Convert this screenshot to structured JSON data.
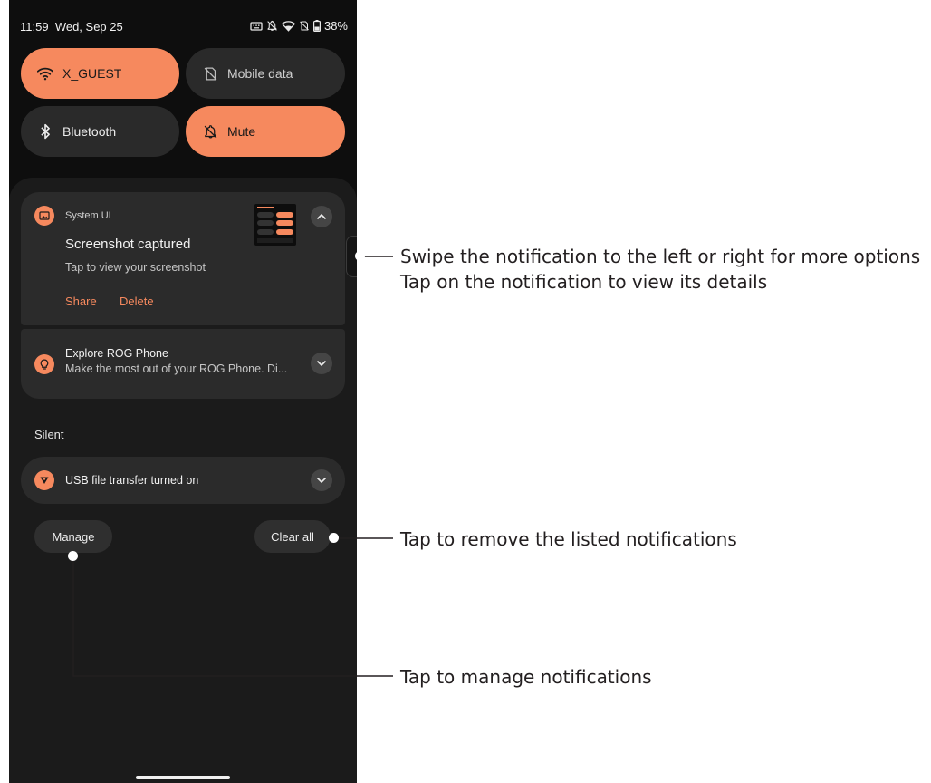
{
  "status_bar": {
    "time": "11:59",
    "date": "Wed, Sep 25",
    "battery": "38%"
  },
  "quick_settings": {
    "wifi": {
      "label": "X_GUEST",
      "icon": "wifi-icon",
      "state": "on"
    },
    "mobile_data": {
      "label": "Mobile data",
      "icon": "mobile-data-off-icon",
      "state": "off"
    },
    "bluetooth": {
      "label": "Bluetooth",
      "icon": "bluetooth-icon",
      "state": "off"
    },
    "mute": {
      "label": "Mute",
      "icon": "bell-off-icon",
      "state": "on"
    }
  },
  "notifications": [
    {
      "app": "System UI",
      "title": "Screenshot captured",
      "body": "Tap to view your screenshot",
      "actions": [
        "Share",
        "Delete"
      ],
      "expanded": true,
      "icon": "image-icon"
    },
    {
      "title": "Explore ROG Phone",
      "body": "Make the most out of your ROG Phone. Di...",
      "expanded": false,
      "icon": "lightbulb-icon"
    }
  ],
  "silent_section": {
    "label": "Silent",
    "notification": {
      "title": "USB file transfer turned on",
      "icon": "usb-icon"
    }
  },
  "buttons": {
    "manage": "Manage",
    "clear_all": "Clear all"
  },
  "callouts": {
    "swipe_line1": "Swipe the notification to the left or right for more options",
    "swipe_line2": "Tap on the notification to view its details",
    "clear": "Tap to remove the listed notifications",
    "manage": "Tap to manage notifications"
  },
  "colors": {
    "accent": "#f6895e",
    "background": "#0e0e0e",
    "card": "#2b2b2b",
    "shade": "#1b1b1b"
  }
}
